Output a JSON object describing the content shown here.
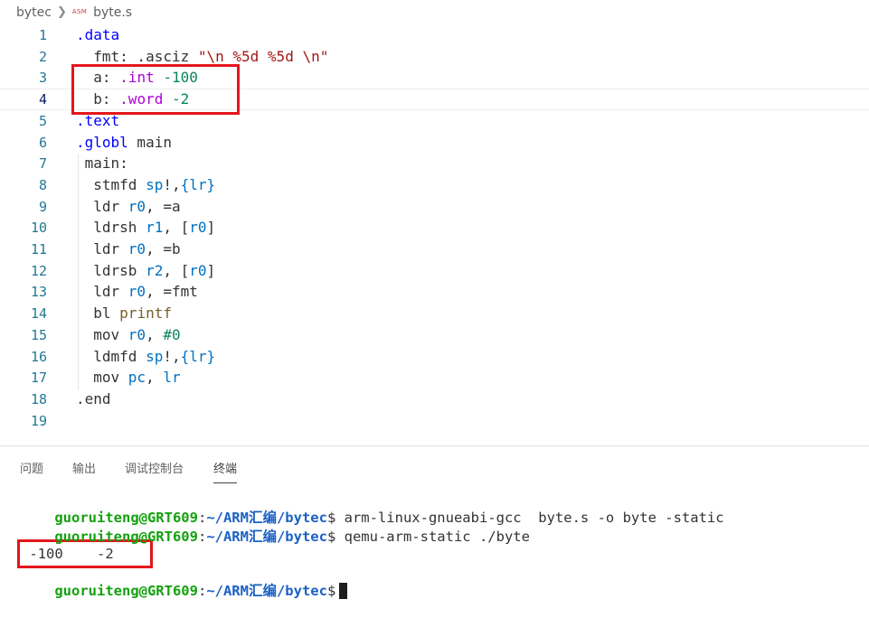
{
  "breadcrumb": {
    "folder": "bytec",
    "file_icon": "ASM",
    "file": "byte.s"
  },
  "editor": {
    "lines": [
      {
        "num": "1",
        "tokens": [
          {
            "t": ".data",
            "c": "t-dir"
          }
        ]
      },
      {
        "num": "2",
        "tokens": [
          {
            "t": "  fmt: .asciz ",
            "c": "t-plain"
          },
          {
            "t": "\"\\n %5d %5d \\n\"",
            "c": "t-str"
          }
        ]
      },
      {
        "num": "3",
        "tokens": [
          {
            "t": "  a: ",
            "c": "t-plain"
          },
          {
            "t": ".int",
            "c": "t-dir2"
          },
          {
            "t": " -100",
            "c": "t-num"
          }
        ]
      },
      {
        "num": "4",
        "tokens": [
          {
            "t": "  b: ",
            "c": "t-plain"
          },
          {
            "t": ".word",
            "c": "t-dir2"
          },
          {
            "t": " -2",
            "c": "t-num"
          }
        ]
      },
      {
        "num": "5",
        "tokens": [
          {
            "t": ".text",
            "c": "t-dir"
          }
        ]
      },
      {
        "num": "6",
        "tokens": [
          {
            "t": ".globl",
            "c": "t-dir"
          },
          {
            "t": " main",
            "c": "t-plain"
          }
        ]
      },
      {
        "num": "7",
        "tokens": [
          {
            "t": " main:",
            "c": "t-plain"
          }
        ]
      },
      {
        "num": "8",
        "tokens": [
          {
            "t": "  stmfd ",
            "c": "t-plain"
          },
          {
            "t": "sp",
            "c": "t-reg"
          },
          {
            "t": "!,",
            "c": "t-plain"
          },
          {
            "t": "{lr}",
            "c": "t-reg"
          }
        ]
      },
      {
        "num": "9",
        "tokens": [
          {
            "t": "  ldr ",
            "c": "t-plain"
          },
          {
            "t": "r0",
            "c": "t-reg"
          },
          {
            "t": ", =a",
            "c": "t-plain"
          }
        ]
      },
      {
        "num": "10",
        "tokens": [
          {
            "t": "  ldrsh ",
            "c": "t-plain"
          },
          {
            "t": "r1",
            "c": "t-reg"
          },
          {
            "t": ", [",
            "c": "t-plain"
          },
          {
            "t": "r0",
            "c": "t-reg"
          },
          {
            "t": "]",
            "c": "t-plain"
          }
        ]
      },
      {
        "num": "11",
        "tokens": [
          {
            "t": "  ldr ",
            "c": "t-plain"
          },
          {
            "t": "r0",
            "c": "t-reg"
          },
          {
            "t": ", =b",
            "c": "t-plain"
          }
        ]
      },
      {
        "num": "12",
        "tokens": [
          {
            "t": "  ldrsb ",
            "c": "t-plain"
          },
          {
            "t": "r2",
            "c": "t-reg"
          },
          {
            "t": ", [",
            "c": "t-plain"
          },
          {
            "t": "r0",
            "c": "t-reg"
          },
          {
            "t": "]",
            "c": "t-plain"
          }
        ]
      },
      {
        "num": "13",
        "tokens": [
          {
            "t": "  ldr ",
            "c": "t-plain"
          },
          {
            "t": "r0",
            "c": "t-reg"
          },
          {
            "t": ", =fmt",
            "c": "t-plain"
          }
        ]
      },
      {
        "num": "14",
        "tokens": [
          {
            "t": "  bl ",
            "c": "t-plain"
          },
          {
            "t": "printf",
            "c": "t-lbl"
          }
        ]
      },
      {
        "num": "15",
        "tokens": [
          {
            "t": "  mov ",
            "c": "t-plain"
          },
          {
            "t": "r0",
            "c": "t-reg"
          },
          {
            "t": ", ",
            "c": "t-plain"
          },
          {
            "t": "#0",
            "c": "t-num"
          }
        ]
      },
      {
        "num": "16",
        "tokens": [
          {
            "t": "  ldmfd ",
            "c": "t-plain"
          },
          {
            "t": "sp",
            "c": "t-reg"
          },
          {
            "t": "!,",
            "c": "t-plain"
          },
          {
            "t": "{lr}",
            "c": "t-reg"
          }
        ]
      },
      {
        "num": "17",
        "tokens": [
          {
            "t": "  mov ",
            "c": "t-plain"
          },
          {
            "t": "pc",
            "c": "t-reg"
          },
          {
            "t": ", ",
            "c": "t-plain"
          },
          {
            "t": "lr",
            "c": "t-reg"
          }
        ]
      },
      {
        "num": "18",
        "tokens": [
          {
            "t": ".end",
            "c": "t-plain"
          }
        ]
      },
      {
        "num": "19",
        "tokens": []
      }
    ],
    "current_line": "4"
  },
  "panel": {
    "tabs": [
      "问题",
      "输出",
      "调试控制台",
      "终端"
    ],
    "active_tab": "终端"
  },
  "terminal": {
    "user": "guoruiteng@GRT609",
    "path": "~/ARM汇编/bytec",
    "commands": [
      "arm-linux-gnueabi-gcc  byte.s -o byte -static",
      "qemu-arm-static ./byte"
    ],
    "output": " -100    -2",
    "colors": {
      "user": "#13a10e",
      "path": "#1b61c4",
      "highlight_box": "#e3161c"
    }
  }
}
